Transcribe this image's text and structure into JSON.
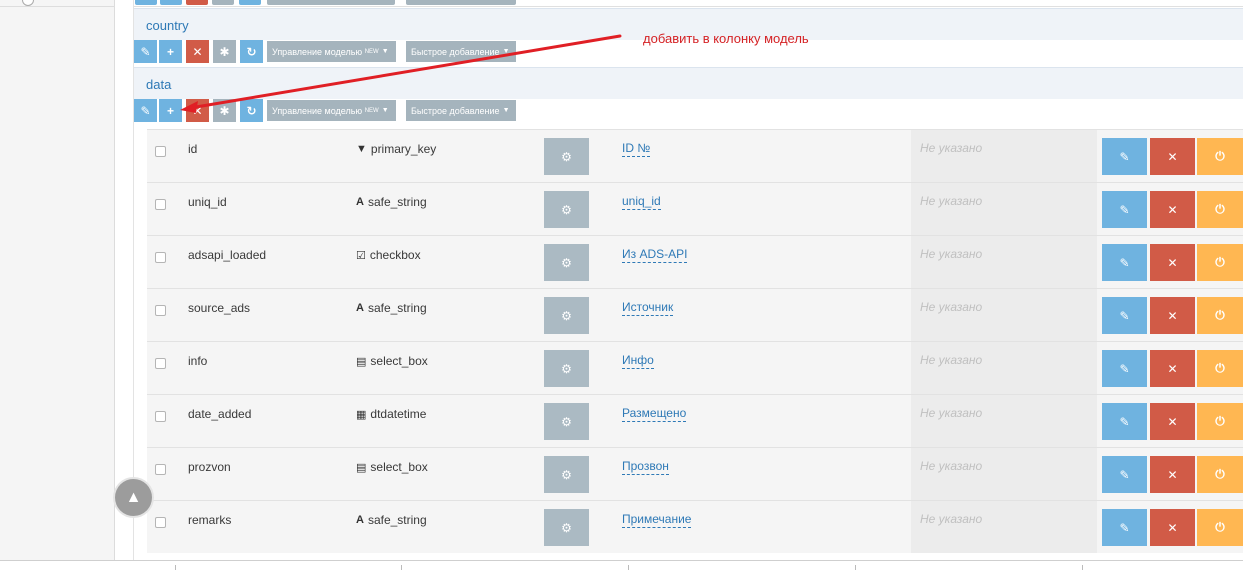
{
  "sections": [
    {
      "title": "country"
    },
    {
      "title": "data"
    }
  ],
  "toolbar": {
    "edit_icon": "✎",
    "add_icon": "+",
    "delete_icon": "✕",
    "asterisk_icon": "✱",
    "refresh_icon": "↻",
    "manage_model_label": "Управление моделью",
    "manage_model_badge": "NEW",
    "quick_add_label": "Быстрое добавление"
  },
  "annotation": {
    "text": "добавить в колонку модель",
    "color": "#d52225"
  },
  "placeholder_text": "Не указано",
  "rows": [
    {
      "name": "id",
      "type": "primary_key",
      "type_icon": "filter-icon",
      "glyph": "▼",
      "label": "ID №"
    },
    {
      "name": "uniq_id",
      "type": "safe_string",
      "type_icon": "font-icon",
      "glyph": "A",
      "label": "uniq_id"
    },
    {
      "name": "adsapi_loaded",
      "type": "checkbox",
      "type_icon": "checkbox-icon",
      "glyph": "☑",
      "label": "Из ADS-API"
    },
    {
      "name": "source_ads",
      "type": "safe_string",
      "type_icon": "font-icon",
      "glyph": "A",
      "label": "Источник"
    },
    {
      "name": "info",
      "type": "select_box",
      "type_icon": "list-box-icon",
      "glyph": "▤",
      "label": "Инфо"
    },
    {
      "name": "date_added",
      "type": "dtdatetime",
      "type_icon": "calendar-icon",
      "glyph": "▦",
      "label": "Размещено"
    },
    {
      "name": "prozvon",
      "type": "select_box",
      "type_icon": "list-box-icon",
      "glyph": "▤",
      "label": "Прозвон"
    },
    {
      "name": "remarks",
      "type": "safe_string",
      "type_icon": "font-icon",
      "glyph": "A",
      "label": "Примечание"
    }
  ],
  "row_actions": {
    "gear_icon": "⚙",
    "edit_icon": "✎",
    "delete_icon": "✕",
    "power_icon": "⏻"
  },
  "scroll_top_icon": "▲",
  "colors": {
    "blue": "#6fb3e0",
    "red": "#d15b47",
    "grey": "#a5b4bd",
    "orange": "#ffb752",
    "link": "#2e79b6"
  }
}
